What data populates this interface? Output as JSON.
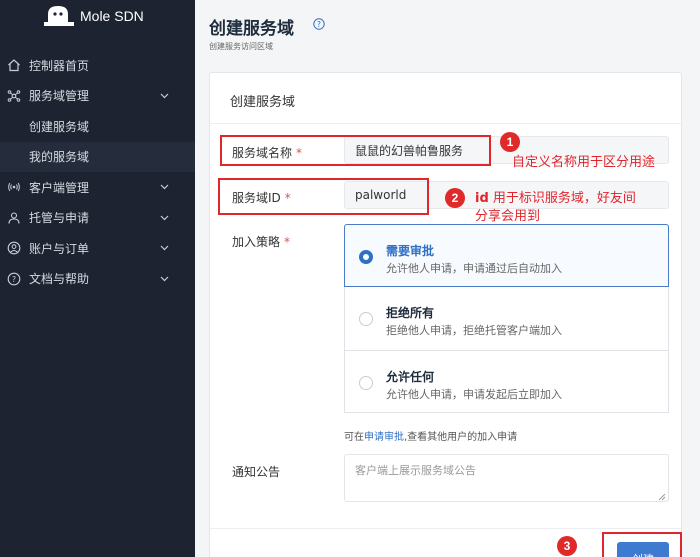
{
  "brand": {
    "name": "Mole SDN"
  },
  "sidebar": {
    "items": [
      {
        "label": "控制器首页",
        "icon": "home-icon"
      },
      {
        "label": "服务域管理",
        "icon": "network-icon",
        "expanded": true
      },
      {
        "label": "创建服务域",
        "sub": true
      },
      {
        "label": "我的服务域",
        "sub": true,
        "active": true
      },
      {
        "label": "客户端管理",
        "icon": "signal-icon"
      },
      {
        "label": "托管与申请",
        "icon": "users-icon"
      },
      {
        "label": "账户与订单",
        "icon": "user-icon"
      },
      {
        "label": "文档与帮助",
        "icon": "help-icon"
      }
    ]
  },
  "page": {
    "title": "创建服务域",
    "subtitle": "创建服务访问区域"
  },
  "form": {
    "card_title": "创建服务域",
    "name_label": "服务域名称",
    "name_value": "鼠鼠的幻兽帕鲁服务",
    "id_label": "服务域ID",
    "id_value": "palworld",
    "required_mark": "*",
    "policy_label": "加入策略",
    "policies": [
      {
        "title": "需要审批",
        "desc": "允许他人申请，申请通过后自动加入",
        "selected": true
      },
      {
        "title": "拒绝所有",
        "desc": "拒绝他人申请，拒绝托管客户端加入",
        "selected": false
      },
      {
        "title": "允许任何",
        "desc": "允许他人申请，申请发起后立即加入",
        "selected": false
      }
    ],
    "hint_prefix": "可在",
    "hint_link": "申请审批",
    "hint_suffix": ",查看其他用户的加入申请",
    "notice_label": "通知公告",
    "notice_placeholder": "客户端上展示服务域公告",
    "create_button": "创建"
  },
  "annotations": {
    "n1": "1",
    "n2": "2",
    "n3": "3",
    "text1": "自定义名称用于区分用途",
    "text2_bold": "id",
    "text2_line1": "用于标识服务域，好友间",
    "text2_line2": "分享会用到"
  },
  "colors": {
    "sidebar_bg": "#1d2330",
    "accent": "#2f6fc4",
    "annotation": "#e0262d"
  }
}
